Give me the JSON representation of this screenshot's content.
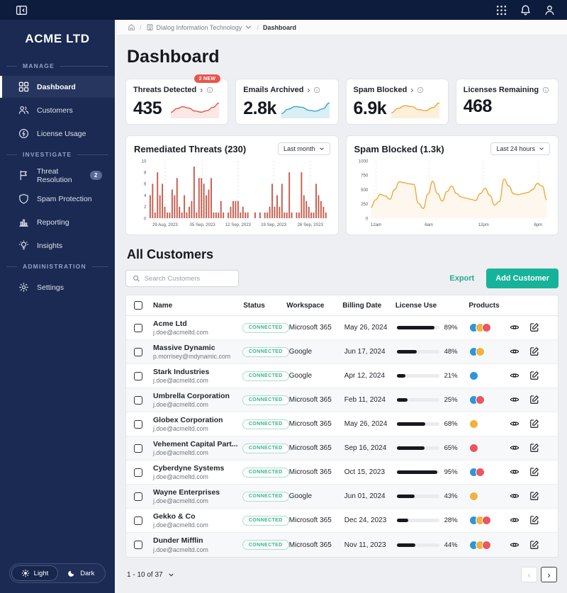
{
  "topbar": {
    "icons": [
      "collapse-sidebar-icon",
      "apps-grid-icon",
      "bell-icon",
      "user-icon"
    ]
  },
  "sidebar": {
    "logo": "ACME LTD",
    "sections": [
      {
        "label": "MANAGE",
        "items": [
          {
            "label": "Dashboard",
            "icon": "dashboard-icon",
            "active": true
          },
          {
            "label": "Customers",
            "icon": "customers-icon"
          },
          {
            "label": "License Usage",
            "icon": "license-usage-icon"
          }
        ]
      },
      {
        "label": "INVESTIGATE",
        "items": [
          {
            "label": "Threat Resolution",
            "icon": "flag-icon",
            "badge": "2"
          },
          {
            "label": "Spam Protection",
            "icon": "shield-icon"
          },
          {
            "label": "Reporting",
            "icon": "reporting-icon"
          },
          {
            "label": "Insights",
            "icon": "insights-icon"
          }
        ]
      },
      {
        "label": "ADMINISTRATION",
        "items": [
          {
            "label": "Settings",
            "icon": "settings-icon"
          }
        ]
      }
    ],
    "theme_toggle": {
      "light_label": "Light",
      "dark_label": "Dark",
      "active": "light"
    }
  },
  "breadcrumb": {
    "org": "Dialog Information Technology",
    "current": "Dashboard"
  },
  "page_title": "Dashboard",
  "stat_cards": [
    {
      "label": "Threats Detected",
      "value": "435",
      "badge": "2 NEW",
      "has_link": true,
      "color": "#d9574b",
      "fill": "#fbe7e4",
      "spark": [
        2.5,
        4.5,
        5.5,
        4.8,
        3.2,
        2.6,
        3.4,
        5.2,
        7.5
      ]
    },
    {
      "label": "Emails Archived",
      "value": "2.8k",
      "has_link": true,
      "color": "#3aa8c9",
      "fill": "#d9eef5",
      "spark": [
        1.8,
        4.2,
        5.6,
        5.2,
        3.6,
        3.1,
        4.4,
        7.6
      ]
    },
    {
      "label": "Spam Blocked",
      "value": "6.9k",
      "has_link": true,
      "color": "#efa63d",
      "fill": "#fdf0da",
      "spark": [
        2.2,
        4.6,
        6.1,
        5.6,
        3.9,
        3.4,
        5.0,
        7.6
      ]
    },
    {
      "label": "Licenses Remaining",
      "value": "468"
    }
  ],
  "chart_data": [
    {
      "type": "bar",
      "title": "Remediated Threats (230)",
      "range_selector": "Last month",
      "ylabel": "",
      "ylim": [
        0,
        10
      ],
      "yticks": [
        0,
        2,
        4,
        6,
        8,
        10
      ],
      "xtick_labels": [
        "29 Aug, 2023",
        "05 Sep, 2023",
        "12 Sep, 2023",
        "19 Sep, 2023",
        "26 Sep, 2023"
      ],
      "xtick_fractions": [
        0.09,
        0.3,
        0.5,
        0.7,
        0.905
      ],
      "bar_color": "#c75b4c",
      "grid": "vertical-dashed",
      "values": [
        4,
        6,
        1,
        8,
        4,
        6,
        2,
        1,
        1,
        5,
        4,
        7,
        2,
        1,
        4,
        1,
        2,
        3,
        9,
        1,
        7,
        7,
        6,
        4,
        5,
        7,
        1,
        1,
        1,
        3,
        1,
        0,
        1,
        2,
        3,
        3,
        3,
        1,
        2,
        1,
        1,
        0,
        0,
        1,
        0,
        1,
        0,
        1,
        1,
        2,
        6,
        2,
        4,
        2,
        6,
        1,
        1,
        8,
        1,
        0,
        1,
        1,
        8,
        4,
        3,
        2,
        1,
        1,
        6,
        4,
        3,
        2,
        1
      ]
    },
    {
      "type": "line",
      "title": "Spam Blocked (1.3k)",
      "range_selector": "Last 24 hours",
      "ylabel": "",
      "ylim": [
        0,
        1000
      ],
      "yticks": [
        0,
        250,
        500,
        750,
        1000
      ],
      "xtick_labels": [
        "12am",
        "6am",
        "12pm",
        "6pm"
      ],
      "xtick_fractions": [
        0.03,
        0.33,
        0.64,
        0.95
      ],
      "line_color": "#f0a63c",
      "area_fill": "#fdf7ed",
      "grid": "vertical-dashed",
      "values": [
        190,
        320,
        415,
        390,
        330,
        500,
        635,
        620,
        600,
        590,
        260,
        170,
        420,
        645,
        430,
        300,
        465,
        560,
        430,
        370,
        350,
        330,
        310,
        430,
        520,
        400,
        230,
        290,
        680,
        560,
        425,
        410,
        430,
        450,
        500,
        605,
        560,
        320
      ]
    }
  ],
  "customers_section": {
    "title": "All Customers",
    "search_placeholder": "Search Customers",
    "export_label": "Export",
    "add_label": "Add Customer",
    "columns": [
      "Name",
      "Status",
      "Workspace",
      "Billing Date",
      "License Use",
      "Products"
    ],
    "product_colors": {
      "blue": "#2e96d8",
      "orange": "#f2b23e",
      "red": "#ea5661"
    },
    "rows": [
      {
        "name": "Acme Ltd",
        "email": "j.doe@acmeltd.com",
        "status": "CONNECTED",
        "workspace": "Microsoft 365",
        "billing_date": "May 26, 2024",
        "license_use": 89,
        "products": [
          "blue",
          "orange",
          "red"
        ]
      },
      {
        "name": "Massive Dynamic",
        "email": "p.morrisey@mdynamic.com",
        "status": "CONNECTED",
        "workspace": "Google",
        "billing_date": "Jun 17, 2024",
        "license_use": 48,
        "products": [
          "blue",
          "orange"
        ]
      },
      {
        "name": "Stark Industries",
        "email": "j.doe@acmeltd.com",
        "status": "CONNECTED",
        "workspace": "Google",
        "billing_date": "Apr 12, 2024",
        "license_use": 21,
        "products": [
          "blue"
        ]
      },
      {
        "name": "Umbrella Corporation",
        "email": "j.doe@acmeltd.com",
        "status": "CONNECTED",
        "workspace": "Microsoft 365",
        "billing_date": "Feb 11, 2024",
        "license_use": 25,
        "products": [
          "blue",
          "red"
        ]
      },
      {
        "name": "Globex Corporation",
        "email": "j.doe@acmeltd.com",
        "status": "CONNECTED",
        "workspace": "Microsoft 365",
        "billing_date": "May 26, 2024",
        "license_use": 68,
        "products": [
          "orange"
        ]
      },
      {
        "name": "Vehement Capital Part...",
        "email": "j.doe@acmeltd.com",
        "status": "CONNECTED",
        "workspace": "Microsoft 365",
        "billing_date": "Sep 16, 2024",
        "license_use": 65,
        "products": [
          "red"
        ]
      },
      {
        "name": "Cyberdyne Systems",
        "email": "j.doe@acmeltd.com",
        "status": "CONNECTED",
        "workspace": "Microsoft 365",
        "billing_date": "Oct 15, 2023",
        "license_use": 95,
        "products": [
          "blue",
          "red"
        ]
      },
      {
        "name": "Wayne Enterprises",
        "email": "j.doe@acmeltd.com",
        "status": "CONNECTED",
        "workspace": "Google",
        "billing_date": "Jun 01, 2024",
        "license_use": 43,
        "products": [
          "orange"
        ]
      },
      {
        "name": "Gekko & Co",
        "email": "j.doe@acmeltd.com",
        "status": "CONNECTED",
        "workspace": "Microsoft 365",
        "billing_date": "Dec 24, 2023",
        "license_use": 28,
        "products": [
          "blue",
          "orange",
          "red"
        ]
      },
      {
        "name": "Dunder Mifflin",
        "email": "j.doe@acmeltd.com",
        "status": "CONNECTED",
        "workspace": "Microsoft 365",
        "billing_date": "Nov 11, 2023",
        "license_use": 44,
        "products": [
          "blue",
          "orange",
          "red"
        ]
      }
    ]
  },
  "pagination": {
    "info": "1 - 10 of 37",
    "prev_enabled": false,
    "next_enabled": true
  },
  "colors": {
    "accent": "#16b39b",
    "topbar": "#0d1b3c",
    "sidebar": "#1b2a52",
    "status": "#3ab48e"
  }
}
